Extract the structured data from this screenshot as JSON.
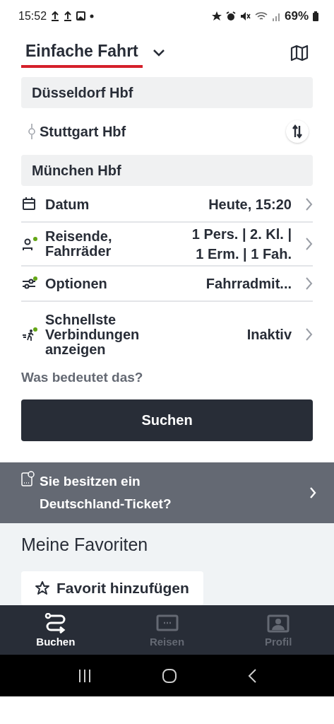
{
  "status_bar": {
    "time": "15:52",
    "battery": "69%"
  },
  "header": {
    "title": "Einfache Fahrt"
  },
  "stations": [
    {
      "kind": "field",
      "name": "Düsseldorf Hbf"
    },
    {
      "kind": "via",
      "name": "Stuttgart Hbf"
    },
    {
      "kind": "field",
      "name": "München Hbf"
    }
  ],
  "options": [
    {
      "label": "Datum",
      "value": "Heute, 15:20",
      "indicator": false
    },
    {
      "label": "Reisende, Fahrräder",
      "value": "1 Pers. | 2. Kl. | 1 Erm. | 1 Fah.",
      "indicator": true
    },
    {
      "label": "Optionen",
      "value": "Fahrradmit...",
      "indicator": true
    },
    {
      "label": "Schnellste Verbindungen anzeigen",
      "value": "Inaktiv",
      "indicator": true
    }
  ],
  "help_link": "Was bedeutet das?",
  "search_button": "Suchen",
  "banner": {
    "text": "Sie besitzen ein Deutschland-Ticket?"
  },
  "favorites": {
    "title": "Meine Favoriten",
    "add_button": "Favorit hinzufügen"
  },
  "bottom_nav": [
    {
      "label": "Buchen",
      "selected": true
    },
    {
      "label": "Reisen",
      "selected": false
    },
    {
      "label": "Profil",
      "selected": false
    }
  ]
}
